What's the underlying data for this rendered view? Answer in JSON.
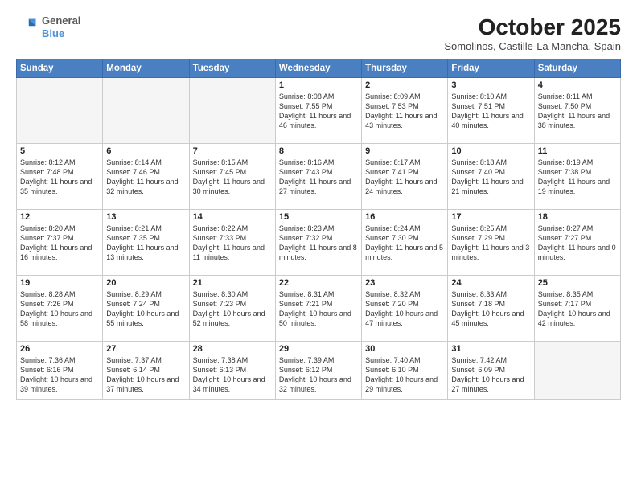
{
  "header": {
    "logo_general": "General",
    "logo_blue": "Blue",
    "month": "October 2025",
    "location": "Somolinos, Castille-La Mancha, Spain"
  },
  "days_of_week": [
    "Sunday",
    "Monday",
    "Tuesday",
    "Wednesday",
    "Thursday",
    "Friday",
    "Saturday"
  ],
  "weeks": [
    [
      {
        "day": "",
        "text": ""
      },
      {
        "day": "",
        "text": ""
      },
      {
        "day": "",
        "text": ""
      },
      {
        "day": "1",
        "text": "Sunrise: 8:08 AM\nSunset: 7:55 PM\nDaylight: 11 hours\nand 46 minutes."
      },
      {
        "day": "2",
        "text": "Sunrise: 8:09 AM\nSunset: 7:53 PM\nDaylight: 11 hours\nand 43 minutes."
      },
      {
        "day": "3",
        "text": "Sunrise: 8:10 AM\nSunset: 7:51 PM\nDaylight: 11 hours\nand 40 minutes."
      },
      {
        "day": "4",
        "text": "Sunrise: 8:11 AM\nSunset: 7:50 PM\nDaylight: 11 hours\nand 38 minutes."
      }
    ],
    [
      {
        "day": "5",
        "text": "Sunrise: 8:12 AM\nSunset: 7:48 PM\nDaylight: 11 hours\nand 35 minutes."
      },
      {
        "day": "6",
        "text": "Sunrise: 8:14 AM\nSunset: 7:46 PM\nDaylight: 11 hours\nand 32 minutes."
      },
      {
        "day": "7",
        "text": "Sunrise: 8:15 AM\nSunset: 7:45 PM\nDaylight: 11 hours\nand 30 minutes."
      },
      {
        "day": "8",
        "text": "Sunrise: 8:16 AM\nSunset: 7:43 PM\nDaylight: 11 hours\nand 27 minutes."
      },
      {
        "day": "9",
        "text": "Sunrise: 8:17 AM\nSunset: 7:41 PM\nDaylight: 11 hours\nand 24 minutes."
      },
      {
        "day": "10",
        "text": "Sunrise: 8:18 AM\nSunset: 7:40 PM\nDaylight: 11 hours\nand 21 minutes."
      },
      {
        "day": "11",
        "text": "Sunrise: 8:19 AM\nSunset: 7:38 PM\nDaylight: 11 hours\nand 19 minutes."
      }
    ],
    [
      {
        "day": "12",
        "text": "Sunrise: 8:20 AM\nSunset: 7:37 PM\nDaylight: 11 hours\nand 16 minutes."
      },
      {
        "day": "13",
        "text": "Sunrise: 8:21 AM\nSunset: 7:35 PM\nDaylight: 11 hours\nand 13 minutes."
      },
      {
        "day": "14",
        "text": "Sunrise: 8:22 AM\nSunset: 7:33 PM\nDaylight: 11 hours\nand 11 minutes."
      },
      {
        "day": "15",
        "text": "Sunrise: 8:23 AM\nSunset: 7:32 PM\nDaylight: 11 hours\nand 8 minutes."
      },
      {
        "day": "16",
        "text": "Sunrise: 8:24 AM\nSunset: 7:30 PM\nDaylight: 11 hours\nand 5 minutes."
      },
      {
        "day": "17",
        "text": "Sunrise: 8:25 AM\nSunset: 7:29 PM\nDaylight: 11 hours\nand 3 minutes."
      },
      {
        "day": "18",
        "text": "Sunrise: 8:27 AM\nSunset: 7:27 PM\nDaylight: 11 hours\nand 0 minutes."
      }
    ],
    [
      {
        "day": "19",
        "text": "Sunrise: 8:28 AM\nSunset: 7:26 PM\nDaylight: 10 hours\nand 58 minutes."
      },
      {
        "day": "20",
        "text": "Sunrise: 8:29 AM\nSunset: 7:24 PM\nDaylight: 10 hours\nand 55 minutes."
      },
      {
        "day": "21",
        "text": "Sunrise: 8:30 AM\nSunset: 7:23 PM\nDaylight: 10 hours\nand 52 minutes."
      },
      {
        "day": "22",
        "text": "Sunrise: 8:31 AM\nSunset: 7:21 PM\nDaylight: 10 hours\nand 50 minutes."
      },
      {
        "day": "23",
        "text": "Sunrise: 8:32 AM\nSunset: 7:20 PM\nDaylight: 10 hours\nand 47 minutes."
      },
      {
        "day": "24",
        "text": "Sunrise: 8:33 AM\nSunset: 7:18 PM\nDaylight: 10 hours\nand 45 minutes."
      },
      {
        "day": "25",
        "text": "Sunrise: 8:35 AM\nSunset: 7:17 PM\nDaylight: 10 hours\nand 42 minutes."
      }
    ],
    [
      {
        "day": "26",
        "text": "Sunrise: 7:36 AM\nSunset: 6:16 PM\nDaylight: 10 hours\nand 39 minutes."
      },
      {
        "day": "27",
        "text": "Sunrise: 7:37 AM\nSunset: 6:14 PM\nDaylight: 10 hours\nand 37 minutes."
      },
      {
        "day": "28",
        "text": "Sunrise: 7:38 AM\nSunset: 6:13 PM\nDaylight: 10 hours\nand 34 minutes."
      },
      {
        "day": "29",
        "text": "Sunrise: 7:39 AM\nSunset: 6:12 PM\nDaylight: 10 hours\nand 32 minutes."
      },
      {
        "day": "30",
        "text": "Sunrise: 7:40 AM\nSunset: 6:10 PM\nDaylight: 10 hours\nand 29 minutes."
      },
      {
        "day": "31",
        "text": "Sunrise: 7:42 AM\nSunset: 6:09 PM\nDaylight: 10 hours\nand 27 minutes."
      },
      {
        "day": "",
        "text": ""
      }
    ]
  ]
}
